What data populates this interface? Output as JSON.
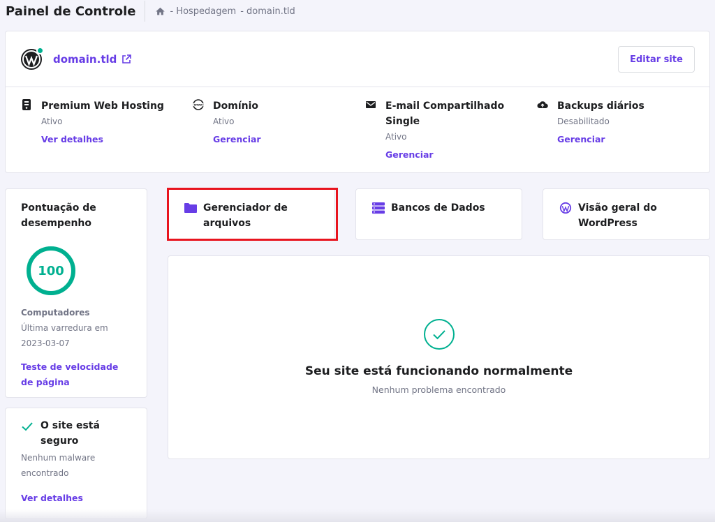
{
  "header": {
    "title": "Painel de Controle",
    "breadcrumb": [
      "- Hospedagem",
      "- domain.tld"
    ]
  },
  "site": {
    "domain": "domain.tld",
    "edit_label": "Editar site",
    "status_dot_color": "#00b090",
    "services": [
      {
        "icon": "server-icon",
        "name": "Premium Web Hosting",
        "status": "Ativo",
        "action": "Ver detalhes"
      },
      {
        "icon": "www-icon",
        "name": "Domínio",
        "status": "Ativo",
        "action": "Gerenciar"
      },
      {
        "icon": "mail-icon",
        "name": "E-mail Compartilhado Single",
        "status": "Ativo",
        "action": "Gerenciar"
      },
      {
        "icon": "cloud-upload-icon",
        "name": "Backups diários",
        "status": "Desabilitado",
        "action": "Gerenciar"
      }
    ]
  },
  "performance": {
    "title": "Pontuação de desempenho",
    "score": "100",
    "score_fraction": 1.0,
    "device": "Computadores",
    "last_scan_label": "Última varredura em",
    "last_scan_date": "2023-03-07",
    "link": "Teste de velocidade de página"
  },
  "security": {
    "title": "O site está seguro",
    "detail": "Nenhum malware encontrado",
    "link": "Ver detalhes"
  },
  "tiles": {
    "file_manager": "Gerenciador de arquivos",
    "databases": "Bancos de Dados",
    "wordpress": "Visão geral do WordPress"
  },
  "status": {
    "headline": "Seu site está funcionando normalmente",
    "sub": "Nenhum problema encontrado"
  },
  "colors": {
    "accent": "#673de6",
    "success": "#00b090",
    "highlight": "#e8141e"
  }
}
